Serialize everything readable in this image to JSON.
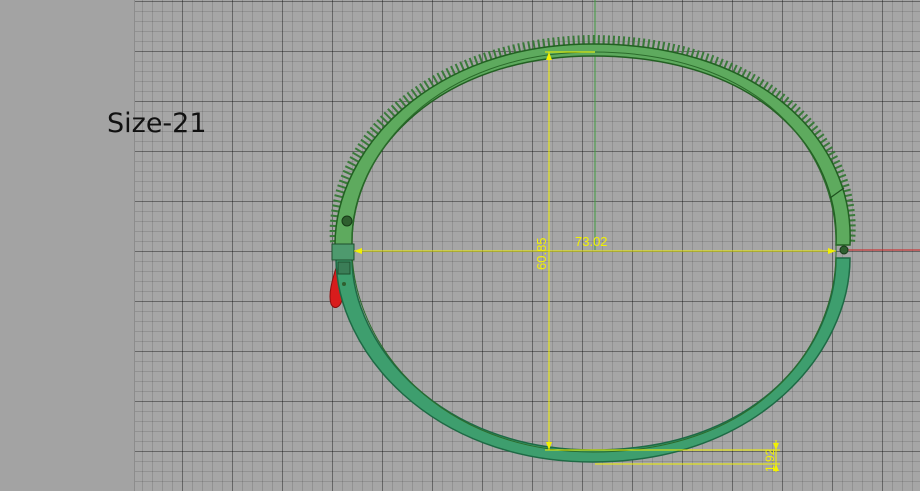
{
  "label": {
    "text": "Size-21"
  },
  "dimensions": {
    "width": "73.02",
    "height": "60.85",
    "thickness": "1.92"
  },
  "colors": {
    "ring_fill": "#5eaa5e",
    "ring_stroke": "#226022",
    "ring_lower_fill": "#3e9e6e",
    "ring_lower_stroke": "#1e6a45",
    "dimension": "#f2f200",
    "axis_y": "#3f9f3f",
    "axis_x": "#d02020",
    "clasp": "#d81c1c"
  },
  "icons": {
    "hinge_left": "hinge-pin-icon",
    "hinge_right": "hinge-pin-icon",
    "clasp": "clasp-latch-icon"
  }
}
